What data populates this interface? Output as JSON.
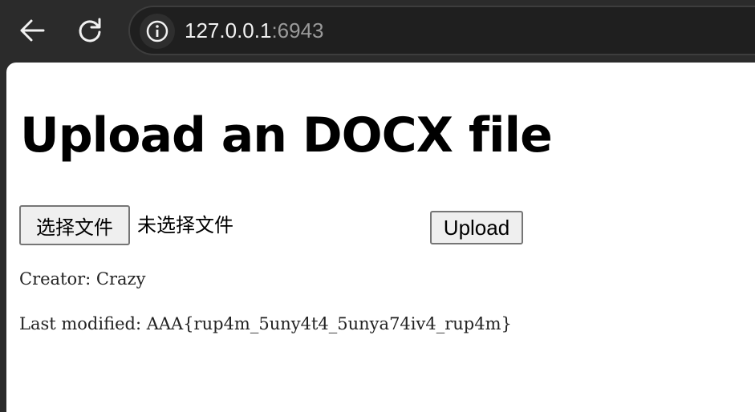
{
  "browser": {
    "url_host": "127.0.0.1",
    "url_port": ":6943",
    "icons": {
      "back": "back-arrow-icon",
      "reload": "reload-icon",
      "site_info": "info-icon"
    }
  },
  "page": {
    "title": "Upload an DOCX file",
    "form": {
      "choose_file_label": "选择文件",
      "file_status": "未选择文件",
      "upload_label": "Upload"
    },
    "metadata": {
      "creator": "Creator: Crazy",
      "last_modified": "Last modified: AAA{rup4m_5uny4t4_5unya74iv4_rup4m}"
    }
  },
  "colors": {
    "toolbar_bg": "#2b2b2b",
    "omnibox_bg": "#1f1f1f",
    "page_bg": "#ffffff",
    "button_bg": "#efefef",
    "button_border": "#767676"
  }
}
